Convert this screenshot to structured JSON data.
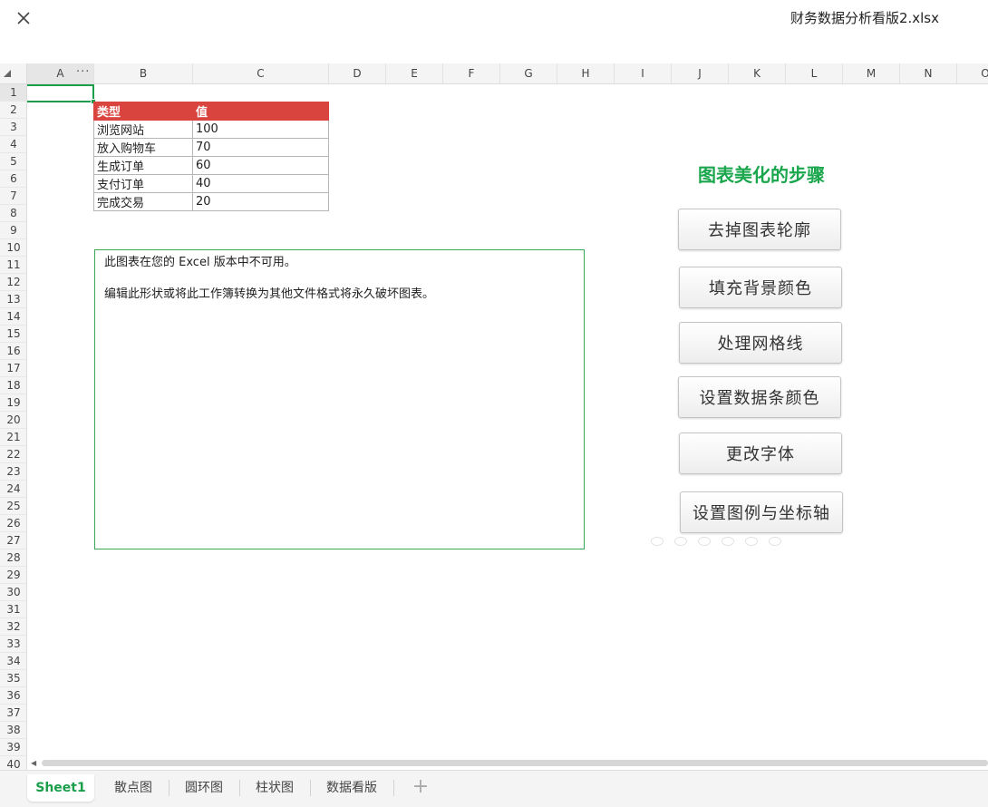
{
  "window": {
    "file_title": "财务数据分析看版2.xlsx",
    "close_icon": "close-icon"
  },
  "grid": {
    "columns": [
      "A",
      "B",
      "C",
      "D",
      "E",
      "F",
      "G",
      "H",
      "I",
      "J",
      "K",
      "L",
      "M",
      "N",
      "O"
    ],
    "more_label": "···",
    "rows": [
      "1",
      "2",
      "3",
      "4",
      "5",
      "6",
      "7",
      "8",
      "9",
      "10",
      "11",
      "12",
      "13",
      "14",
      "15",
      "16",
      "17",
      "18",
      "19",
      "20",
      "21",
      "22",
      "23",
      "24",
      "25",
      "26",
      "27",
      "28",
      "29",
      "30",
      "31",
      "32",
      "33",
      "34",
      "35",
      "36",
      "37",
      "38",
      "39",
      "40"
    ],
    "selected_cell": "A1"
  },
  "table": {
    "headers": [
      "类型",
      "值"
    ],
    "rows": [
      [
        "浏览网站",
        "100"
      ],
      [
        "放入购物车",
        "70"
      ],
      [
        "生成订单",
        "60"
      ],
      [
        "支付订单",
        "40"
      ],
      [
        "完成交易",
        "20"
      ]
    ],
    "header_color": "#d9443f"
  },
  "chart_placeholder": {
    "line1": "此图表在您的 Excel 版本中不可用。",
    "line2": "编辑此形状或将此工作簿转换为其他文件格式将永久破坏图表。"
  },
  "steps": {
    "title": "图表美化的步骤",
    "title_color": "#1aa64d",
    "buttons": [
      "去掉图表轮廓",
      "填充背景颜色",
      "处理网格线",
      "设置数据条颜色",
      "更改字体",
      "设置图例与坐标轴"
    ]
  },
  "tabs": {
    "items": [
      "Sheet1",
      "散点图",
      "圆环图",
      "柱状图",
      "数据看版"
    ],
    "active_index": 0,
    "add_label": "+",
    "accent": "#1a9e4a"
  }
}
